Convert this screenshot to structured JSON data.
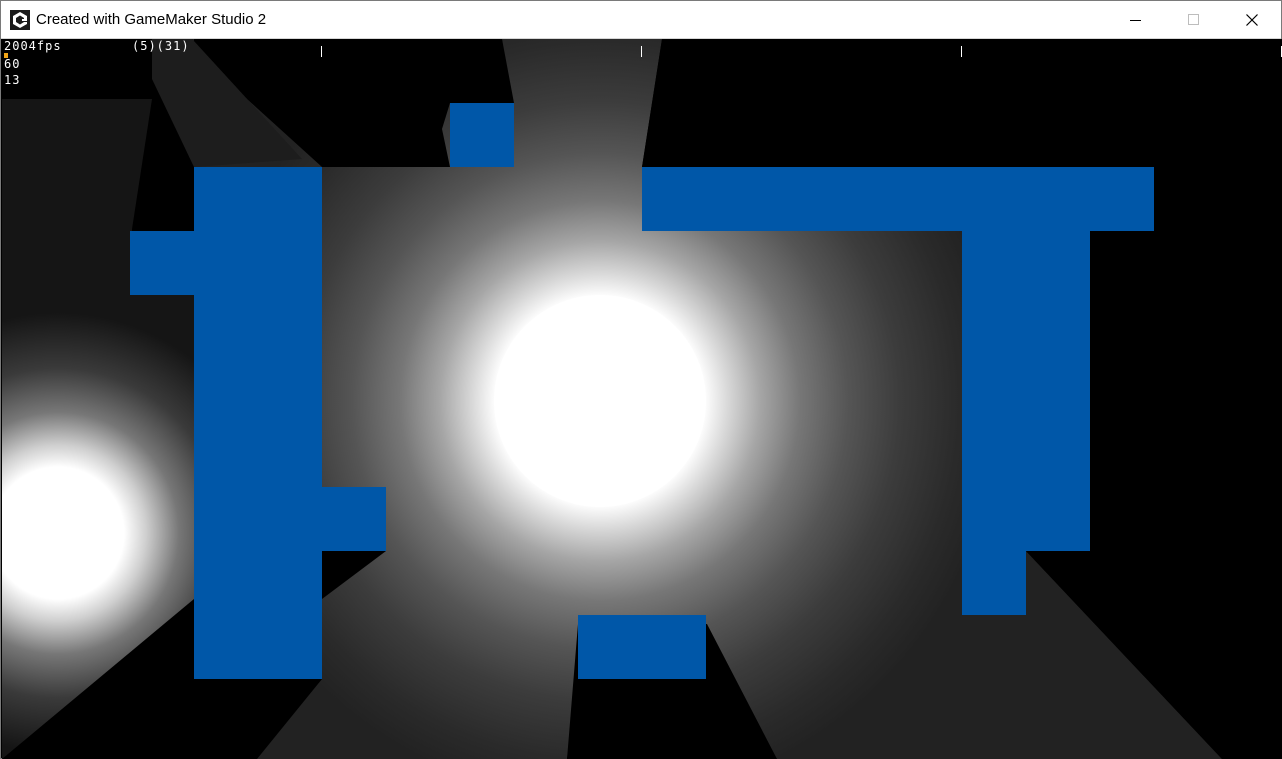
{
  "window": {
    "title": "Created with GameMaker Studio 2",
    "icon": "gamemaker-logo-icon",
    "controls": {
      "minimize": "minimize-icon",
      "maximize": "maximize-icon",
      "close": "close-icon"
    }
  },
  "debug": {
    "fps": "2004fps",
    "counter": "(5)(31)",
    "line2": "60",
    "line3": "13"
  },
  "colors": {
    "wall": "#0057a8",
    "background": "#000000",
    "light": "#ffffff",
    "fps_bar": "#f2a516"
  }
}
